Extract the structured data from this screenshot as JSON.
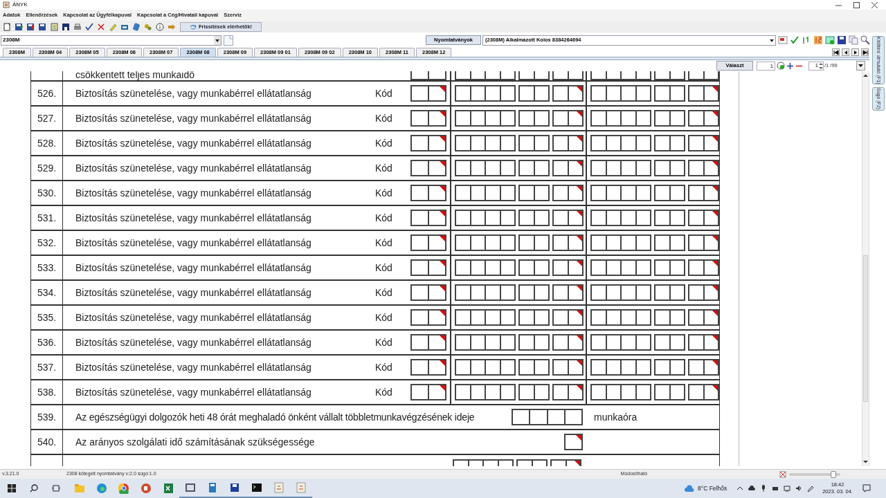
{
  "window": {
    "title": "ÁNYK"
  },
  "menu": [
    "Adatok",
    "Ellenőrzések",
    "Kapcsolat az Ügyfélkapuval",
    "Kapcsolat a Cég/Hivatali kapuval",
    "Szerviz"
  ],
  "toolbar": {
    "update_button": "Frissítések elérhetők!"
  },
  "form_selector": {
    "value": "2308M"
  },
  "forms_button": "Nyomtatványok",
  "document_selector": {
    "value": "(2308M) Alkalmazott Kolos 8384264694"
  },
  "tabs": [
    {
      "label": "2308M",
      "selected": false
    },
    {
      "label": "2308M 04",
      "selected": false
    },
    {
      "label": "2308M 05",
      "selected": false
    },
    {
      "label": "2308M 06",
      "selected": false
    },
    {
      "label": "2308M 07",
      "selected": false
    },
    {
      "label": "2308M 08",
      "selected": true
    },
    {
      "label": "2308M 09",
      "selected": false
    },
    {
      "label": "2308M 09 01",
      "selected": false
    },
    {
      "label": "2308M 09 02",
      "selected": false
    },
    {
      "label": "2308M 10",
      "selected": false
    },
    {
      "label": "2308M 11",
      "selected": false
    },
    {
      "label": "2308M 12",
      "selected": false
    }
  ],
  "page_nav": {
    "choose_button": "Választ",
    "page_field": "1",
    "sub_field": "1",
    "page_count": "/1 /99"
  },
  "side_tabs": [
    "Kitöltési útmutató (F1)",
    "Súgó (F2)"
  ],
  "form": {
    "partial_top_text": "csökkentett teljes munkaidő",
    "code_rows": [
      {
        "number": "526.",
        "label": "Biztosítás szünetelése, vagy munkabérrel ellátatlanság",
        "code_label": "Kód"
      },
      {
        "number": "527.",
        "label": "Biztosítás szünetelése, vagy munkabérrel ellátatlanság",
        "code_label": "Kód"
      },
      {
        "number": "528.",
        "label": "Biztosítás szünetelése, vagy munkabérrel ellátatlanság",
        "code_label": "Kód"
      },
      {
        "number": "529.",
        "label": "Biztosítás szünetelése, vagy munkabérrel ellátatlanság",
        "code_label": "Kód"
      },
      {
        "number": "530.",
        "label": "Biztosítás szünetelése, vagy munkabérrel ellátatlanság",
        "code_label": "Kód"
      },
      {
        "number": "531.",
        "label": "Biztosítás szünetelése, vagy munkabérrel ellátatlanság",
        "code_label": "Kód"
      },
      {
        "number": "532.",
        "label": "Biztosítás szünetelése, vagy munkabérrel ellátatlanság",
        "code_label": "Kód"
      },
      {
        "number": "533.",
        "label": "Biztosítás szünetelése, vagy munkabérrel ellátatlanság",
        "code_label": "Kód"
      },
      {
        "number": "534.",
        "label": "Biztosítás szünetelése, vagy munkabérrel ellátatlanság",
        "code_label": "Kód"
      },
      {
        "number": "535.",
        "label": "Biztosítás szünetelése, vagy munkabérrel ellátatlanság",
        "code_label": "Kód"
      },
      {
        "number": "536.",
        "label": "Biztosítás szünetelése, vagy munkabérrel ellátatlanság",
        "code_label": "Kód"
      },
      {
        "number": "537.",
        "label": "Biztosítás szünetelése, vagy munkabérrel ellátatlanság",
        "code_label": "Kód"
      },
      {
        "number": "538.",
        "label": "Biztosítás szünetelése, vagy munkabérrel ellátatlanság",
        "code_label": "Kód"
      }
    ],
    "hours_row": {
      "number": "539.",
      "label": "Az egészségügyi dolgozók heti 48 órát meghaladó önként vállalt többletmunkavégzésének ideje",
      "unit": "munkaóra"
    },
    "flag_row": {
      "number": "540.",
      "label": "Az arányos szolgálati idő számításának szükségessége"
    }
  },
  "status_bar": {
    "version": "v.3.21.0",
    "form_info": "2308 kötegelt nyomtatvány v:2.0 súgó:1.0",
    "mode": "Módosítható"
  },
  "taskbar": {
    "weather": "8°C Felhős",
    "time": "18:42",
    "date": "2023. 03. 04."
  }
}
